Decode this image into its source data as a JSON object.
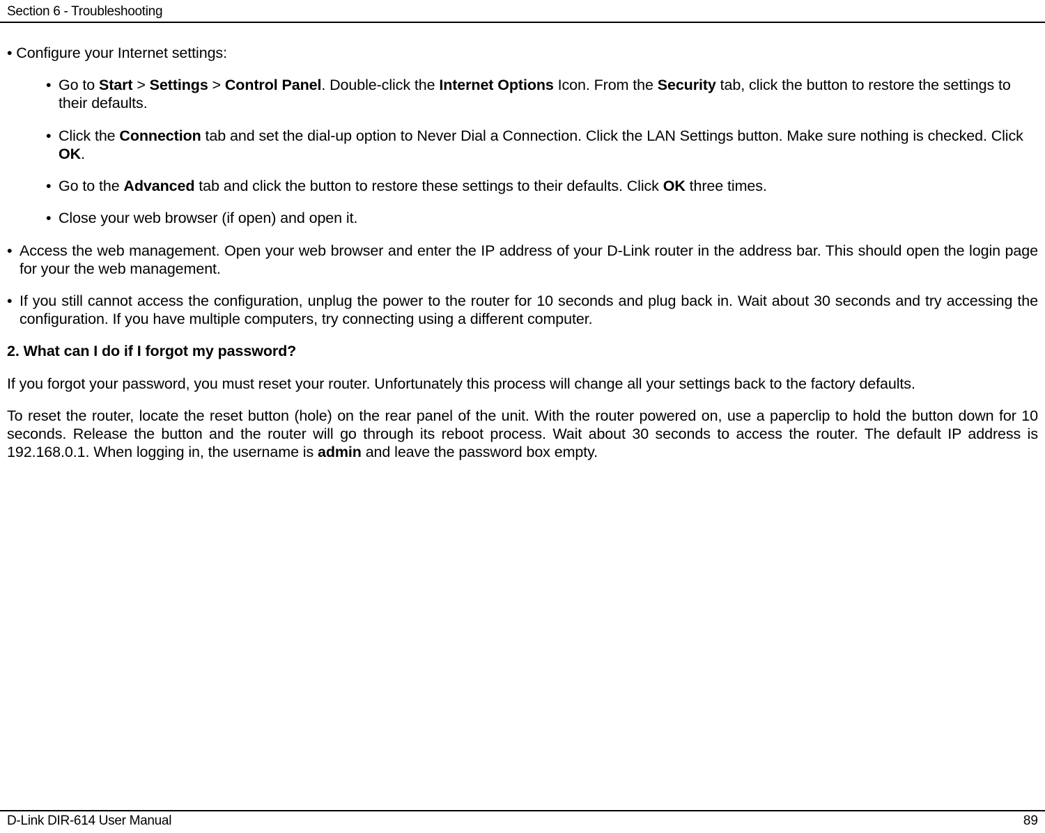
{
  "header": {
    "section_title": "Section 6 - Troubleshooting"
  },
  "body": {
    "configure_intro": "• Configure your Internet settings:",
    "sub_items": [
      {
        "marker": "•",
        "pre": "Go to ",
        "b1": "Start",
        "t1": " > ",
        "b2": "Settings",
        "t2": " > ",
        "b3": "Control Panel",
        "t3": ". Double-click the ",
        "b4": "Internet Options",
        "t4": " Icon. From the ",
        "b5": "Security",
        "t5": " tab, click the button to restore the settings to their defaults."
      },
      {
        "marker": "•",
        "pre": "Click the ",
        "b1": "Connection",
        "t1": " tab and set the dial-up option to Never Dial a Connection. Click the LAN Settings button. Make sure nothing is checked. Click ",
        "b2": "OK",
        "t2": "."
      },
      {
        "marker": "•",
        "pre": "Go to the ",
        "b1": "Advanced",
        "t1": " tab and click the button to restore these settings to their defaults. Click ",
        "b2": "OK",
        "t2": " three times."
      },
      {
        "marker": "•",
        "pre": "Close your web browser (if open) and open it."
      }
    ],
    "l1_items": [
      {
        "marker": "•",
        "text": "Access the web management. Open your web browser and enter the IP address of your D-Link router in the address bar. This should open the login page for your the web management."
      },
      {
        "marker": "•",
        "text": "If you still cannot access the configuration, unplug the power to the router for 10 seconds and plug back in. Wait about 30 seconds and try accessing the configuration. If you have multiple computers, try connecting using a different computer."
      }
    ],
    "heading2": "2. What can I do if I forgot my password?",
    "para1": "If you forgot your password, you must reset your router. Unfortunately this process will change all your settings back to the factory defaults.",
    "para2_pre": "To reset the router, locate the reset button (hole) on the rear panel of the unit. With the router powered on, use a paperclip to hold the button down for 10 seconds. Release the button and the router will go through its reboot process. Wait about 30 seconds to access the router. The default IP address is 192.168.0.1. When logging in, the username is ",
    "para2_b": "admin",
    "para2_post": " and leave the password box empty."
  },
  "footer": {
    "left": "D-Link DIR-614 User Manual",
    "right": "89"
  }
}
